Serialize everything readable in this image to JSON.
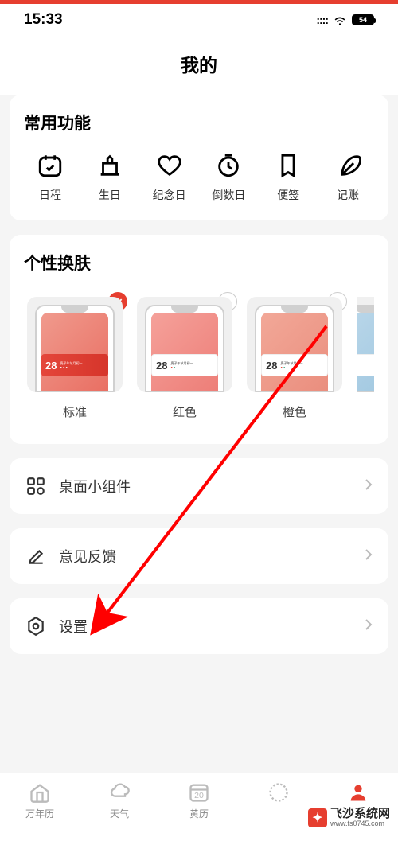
{
  "status": {
    "time": "15:33",
    "battery": "54"
  },
  "page": {
    "title": "我的"
  },
  "common_functions": {
    "title": "常用功能",
    "items": [
      {
        "label": "日程"
      },
      {
        "label": "生日"
      },
      {
        "label": "纪念日"
      },
      {
        "label": "倒数日"
      },
      {
        "label": "便签"
      },
      {
        "label": "记账"
      }
    ]
  },
  "themes": {
    "title": "个性换肤",
    "items": [
      {
        "label": "标准",
        "selected": true,
        "date": "28"
      },
      {
        "label": "红色",
        "selected": false,
        "date": "28"
      },
      {
        "label": "橙色",
        "selected": false,
        "date": "28"
      }
    ]
  },
  "menu": {
    "widgets": "桌面小组件",
    "feedback": "意见反馈",
    "settings": "设置"
  },
  "tabs": {
    "calendar": "万年历",
    "weather": "天气",
    "huangli": "黄历",
    "huangli_day": "20",
    "me": "我的"
  },
  "watermark": {
    "main": "飞沙系统网",
    "url": "www.fs0745.com"
  },
  "colors": {
    "accent": "#e63e2f",
    "standard_bg": "linear-gradient(135deg,#f09a8d,#e96f63)",
    "red_bg": "linear-gradient(135deg,#f5a19a,#ed7e78)",
    "orange_bg": "linear-gradient(135deg,#f2a898,#ea8e7e)"
  }
}
